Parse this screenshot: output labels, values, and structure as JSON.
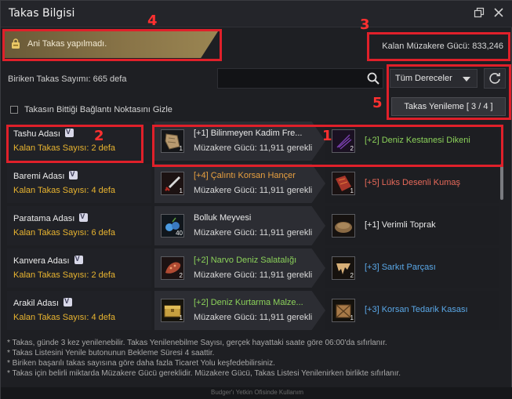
{
  "window": {
    "title": "Takas Bilgisi"
  },
  "notice": {
    "text": "Ani Takas yapılmadı."
  },
  "header": {
    "power_label": "Kalan Müzakere Gücü: 833,246",
    "accumulated": "Biriken Takas Sayımı: 665 defa",
    "search_placeholder": "",
    "grade_filter": "Tüm Dereceler",
    "hide_checkbox_label": "Takasın Bittiği Bağlantı Noktasını Gizle",
    "renew_button": "Takas Yenileme [ 3 / 4 ]"
  },
  "annotations": [
    "1",
    "2",
    "3",
    "4",
    "5"
  ],
  "rows": [
    {
      "island": "Tashu Adası",
      "count": "Kalan Takas Sayısı: 2 defa",
      "give_name": "[+1] Bilinmeyen Kadim Fre...",
      "give_color": "white",
      "give_qty": "1",
      "give_icon": "ancient-fragment-icon",
      "req": "Müzakere Gücü: 11,911 gerekli",
      "get_name": "[+2] Deniz Kestanesi Dikeni",
      "get_color": "green",
      "get_qty": "2",
      "get_icon": "sea-urchin-spine-icon"
    },
    {
      "island": "Baremi Adası",
      "count": "Kalan Takas Sayısı: 4 defa",
      "give_name": "[+4] Çalıntı Korsan Hançer",
      "give_color": "orange",
      "give_qty": "1",
      "give_icon": "dagger-icon",
      "req": "Müzakere Gücü: 11,911 gerekli",
      "get_name": "[+5] Lüks Desenli Kumaş",
      "get_color": "red",
      "get_qty": "1",
      "get_icon": "fabric-icon"
    },
    {
      "island": "Paratama Adası",
      "count": "Kalan Takas Sayısı: 6 defa",
      "give_name": "Bolluk Meyvesi",
      "give_color": "white",
      "give_qty": "40",
      "give_icon": "berry-icon",
      "req": "Müzakere Gücü: 11,911 gerekli",
      "get_name": "[+1] Verimli Toprak",
      "get_color": "white",
      "get_qty": "",
      "get_icon": "soil-icon"
    },
    {
      "island": "Kanvera Adası",
      "count": "Kalan Takas Sayısı: 2 defa",
      "give_name": "[+2] Narvo Deniz Salatalığı",
      "give_color": "green",
      "give_qty": "2",
      "give_icon": "sea-cucumber-icon",
      "req": "Müzakere Gücü: 11,911 gerekli",
      "get_name": "[+3] Sarkıt Parçası",
      "get_color": "blue",
      "get_qty": "2",
      "get_icon": "stalactite-icon"
    },
    {
      "island": "Arakil Adası",
      "count": "Kalan Takas Sayısı: 4 defa",
      "give_name": "[+2] Deniz Kurtarma Malze...",
      "give_color": "green",
      "give_qty": "1",
      "give_icon": "rescue-crate-icon",
      "req": "Müzakere Gücü: 11,911 gerekli",
      "get_name": "[+3] Korsan Tedarik Kasası",
      "get_color": "blue",
      "get_qty": "1",
      "get_icon": "supply-crate-icon"
    }
  ],
  "notes": [
    "* Takas, günde 3 kez yenilenebilir. Takas Yenilenebilme Sayısı, gerçek hayattaki saate göre 06:00'da sıfırlanır.",
    "* Takas Listesini Yenile butonunun Bekleme Süresi 4 saattir.",
    "* Biriken başarılı takas sayısına göre daha fazla Ticaret Yolu keşfedebilirsiniz.",
    "* Takas için belirli miktarda Müzakere Gücü gereklidir. Müzakere Gücü, Takas Listesi Yenilenirken birlikte sıfırlanır."
  ],
  "footer": {
    "text": "Budger'ı Yetkin Ofisinde Kullanım"
  },
  "colors": {
    "annotation": "#e0202a",
    "count": "#e8b430",
    "green": "#8bd15a",
    "blue": "#5aa8e8",
    "red": "#e86a5a",
    "orange": "#e8a040"
  }
}
